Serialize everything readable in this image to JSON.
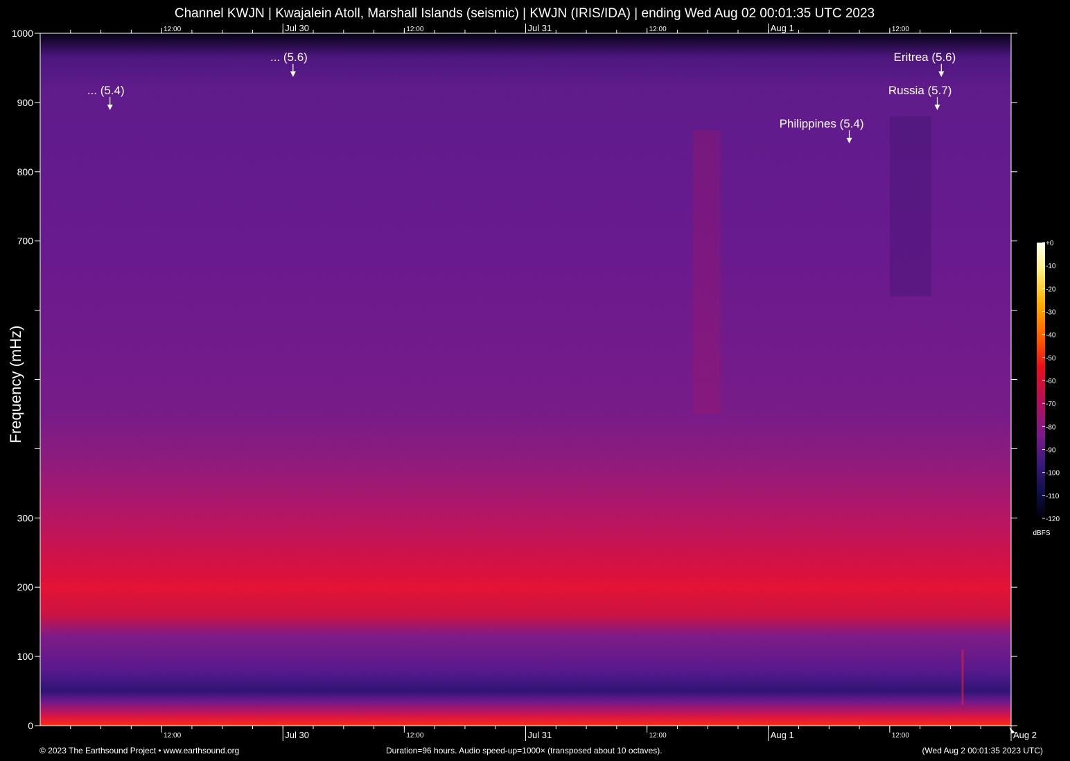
{
  "title": "Channel KWJN | Kwajalein Atoll, Marshall Islands (seismic) | KWJN (IRIS/IDA) | ending Wed Aug 02 00:01:35 UTC 2023",
  "footer": {
    "copyright": "© 2023 The Earthsound Project • www.earthsound.org",
    "duration": "Duration=96 hours. Audio speed-up=1000× (transposed about 10 octaves).",
    "timestamp": "(Wed Aug  2 00:01:35 2023 UTC)"
  },
  "colors": {
    "background": "#000000",
    "noise_floor": "#6a1a8a",
    "band_peak": "#e01030",
    "text": "#ffffff"
  },
  "chart_data": {
    "type": "heatmap",
    "title": "Channel KWJN | Kwajalein Atoll, Marshall Islands (seismic) | KWJN (IRIS/IDA) | ending Wed Aug 02 00:01:35 UTC 2023",
    "xlabel": "",
    "ylabel": "Frequency (mHz)",
    "xlim_hours": [
      0,
      96
    ],
    "ylim": [
      0,
      1000
    ],
    "x_major_ticks": [
      {
        "label": "12:00",
        "hour": 12
      },
      {
        "label": "Jul 30",
        "hour": 24
      },
      {
        "label": "12:00",
        "hour": 36
      },
      {
        "label": "Jul 31",
        "hour": 48
      },
      {
        "label": "12:00",
        "hour": 60
      },
      {
        "label": "Aug  1",
        "hour": 72
      },
      {
        "label": "12:00",
        "hour": 84
      },
      {
        "label": "Aug  2",
        "hour": 96
      }
    ],
    "y_ticks": [
      {
        "value": 0,
        "label": "0"
      },
      {
        "value": 100,
        "label": "100"
      },
      {
        "value": 200,
        "label": "200"
      },
      {
        "value": 300,
        "label": "300"
      },
      {
        "value": 400,
        "label": ""
      },
      {
        "value": 500,
        "label": ""
      },
      {
        "value": 600,
        "label": ""
      },
      {
        "value": 700,
        "label": "700"
      },
      {
        "value": 800,
        "label": "800"
      },
      {
        "value": 900,
        "label": "900"
      },
      {
        "value": 1000,
        "label": "1000"
      }
    ],
    "events": [
      {
        "label": "... (5.4)",
        "hour": 6.9,
        "freq": 890
      },
      {
        "label": "... (5.6)",
        "hour": 25.0,
        "freq": 938
      },
      {
        "label": "Philippines (5.4)",
        "hour": 80.0,
        "freq": 842
      },
      {
        "label": "Russia (5.7)",
        "hour": 88.7,
        "freq": 890
      },
      {
        "label": "Eritrea (5.6)",
        "hour": 89.1,
        "freq": 938
      }
    ],
    "colorbar": {
      "unit": "dBFS",
      "ticks": [
        "+0",
        "-10",
        "-20",
        "-30",
        "-40",
        "-50",
        "-60",
        "-70",
        "-80",
        "-90",
        "-100",
        "-110",
        "-120"
      ],
      "range": [
        -120,
        0
      ]
    },
    "grid": false,
    "legend": "colorbar right"
  }
}
